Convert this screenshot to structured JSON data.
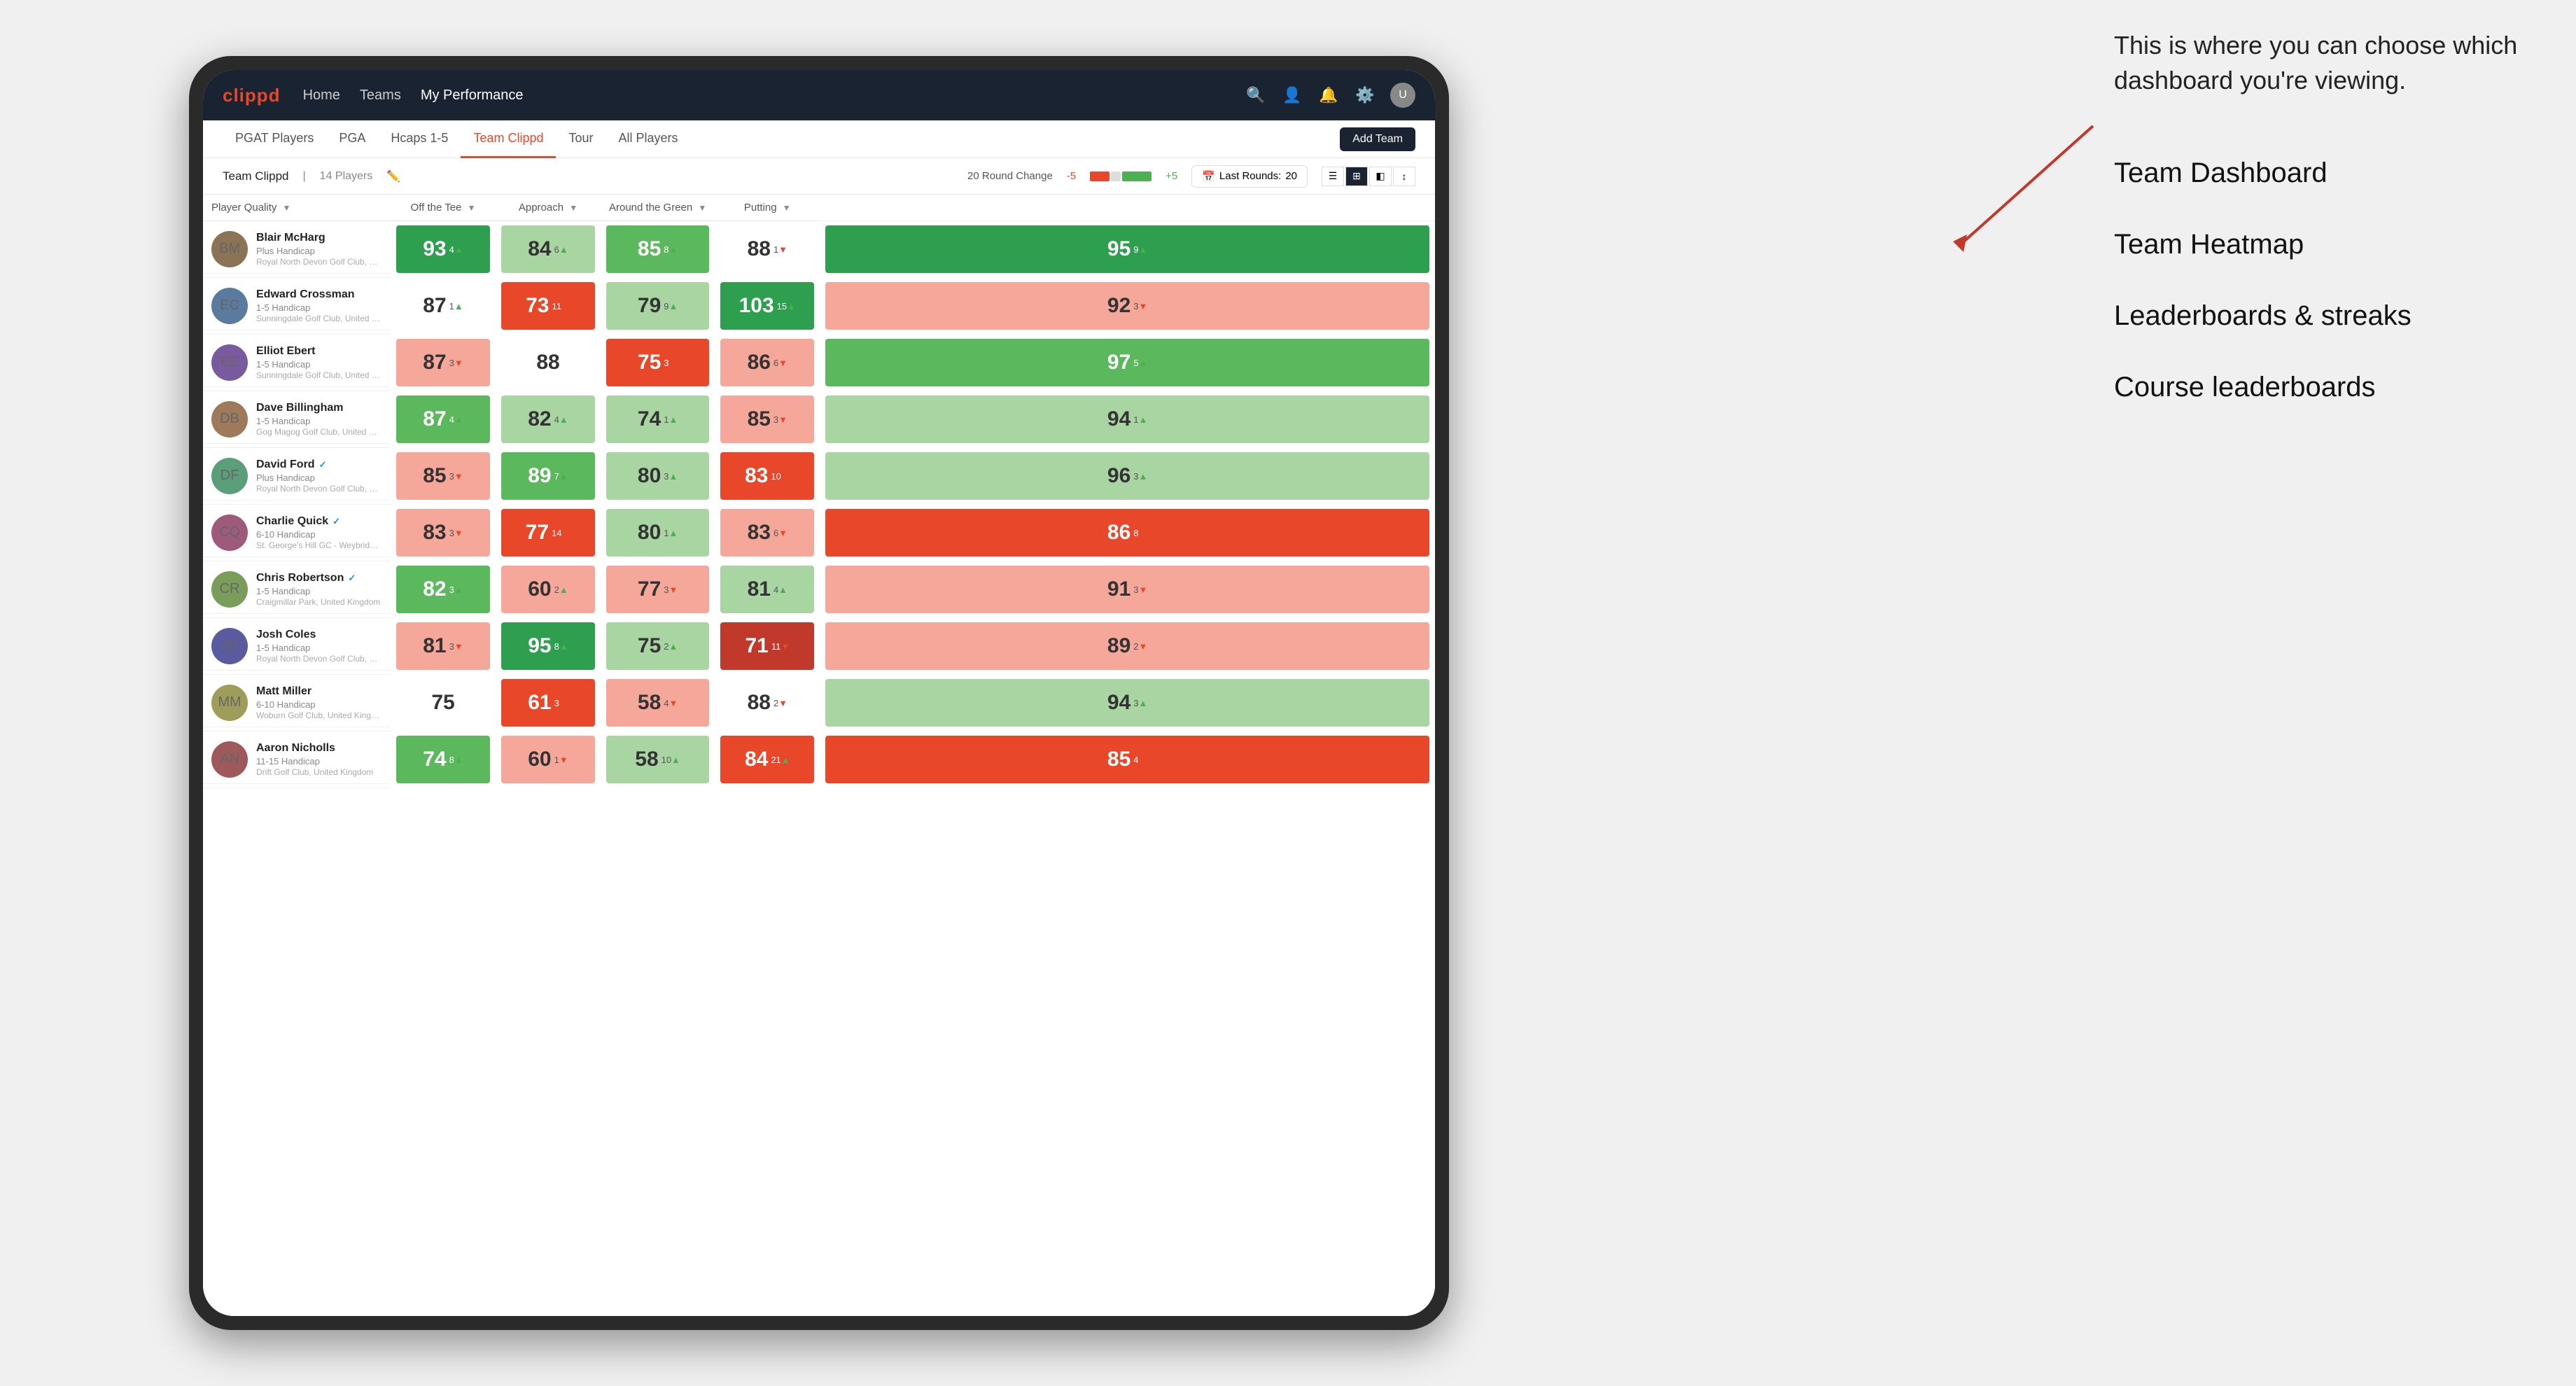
{
  "annotation": {
    "description": "This is where you can choose which dashboard you're viewing.",
    "menu_options": [
      "Team Dashboard",
      "Team Heatmap",
      "Leaderboards & streaks",
      "Course leaderboards"
    ]
  },
  "nav": {
    "logo": "clippd",
    "items": [
      "Home",
      "Teams",
      "My Performance"
    ],
    "active_item": "My Performance"
  },
  "sub_nav": {
    "items": [
      "PGAT Players",
      "PGA",
      "Hcaps 1-5",
      "Team Clippd",
      "Tour",
      "All Players"
    ],
    "active_item": "Team Clippd",
    "add_team_label": "Add Team"
  },
  "team_header": {
    "title": "Team Clippd",
    "separator": "|",
    "count": "14 Players",
    "round_change_label": "20 Round Change",
    "change_neg": "-5",
    "change_pos": "+5",
    "last_rounds_label": "Last Rounds:",
    "last_rounds_value": "20"
  },
  "table": {
    "columns": [
      {
        "id": "player",
        "label": "Player Quality",
        "sortable": true
      },
      {
        "id": "off_tee",
        "label": "Off the Tee",
        "sortable": true
      },
      {
        "id": "approach",
        "label": "Approach",
        "sortable": true
      },
      {
        "id": "around_green",
        "label": "Around the Green",
        "sortable": true
      },
      {
        "id": "putting",
        "label": "Putting",
        "sortable": true
      }
    ],
    "players": [
      {
        "name": "Blair McHarg",
        "handicap": "Plus Handicap",
        "club": "Royal North Devon Golf Club, United Kingdom",
        "verified": false,
        "avatar_color": "av1",
        "initials": "BM",
        "scores": [
          {
            "value": 93,
            "change": 4,
            "dir": "up",
            "bg": "bg-green-dark",
            "text": "score-colored"
          },
          {
            "value": 84,
            "change": 6,
            "dir": "up",
            "bg": "bg-green-light",
            "text": "score-white"
          },
          {
            "value": 85,
            "change": 8,
            "dir": "up",
            "bg": "bg-green-mid",
            "text": "score-colored"
          },
          {
            "value": 88,
            "change": 1,
            "dir": "down",
            "bg": "bg-white",
            "text": "score-white"
          },
          {
            "value": 95,
            "change": 9,
            "dir": "up",
            "bg": "bg-green-dark",
            "text": "score-colored"
          }
        ]
      },
      {
        "name": "Edward Crossman",
        "handicap": "1-5 Handicap",
        "club": "Sunningdale Golf Club, United Kingdom",
        "verified": false,
        "avatar_color": "av2",
        "initials": "EC",
        "scores": [
          {
            "value": 87,
            "change": 1,
            "dir": "up",
            "bg": "bg-white",
            "text": "score-white"
          },
          {
            "value": 73,
            "change": 11,
            "dir": "down",
            "bg": "bg-red-mid",
            "text": "score-colored"
          },
          {
            "value": 79,
            "change": 9,
            "dir": "up",
            "bg": "bg-green-light",
            "text": "score-white"
          },
          {
            "value": 103,
            "change": 15,
            "dir": "up",
            "bg": "bg-green-dark",
            "text": "score-colored"
          },
          {
            "value": 92,
            "change": 3,
            "dir": "down",
            "bg": "bg-red-light",
            "text": "score-white"
          }
        ]
      },
      {
        "name": "Elliot Ebert",
        "handicap": "1-5 Handicap",
        "club": "Sunningdale Golf Club, United Kingdom",
        "verified": false,
        "avatar_color": "av3",
        "initials": "EE",
        "scores": [
          {
            "value": 87,
            "change": 3,
            "dir": "down",
            "bg": "bg-red-light",
            "text": "score-white"
          },
          {
            "value": 88,
            "change": null,
            "dir": null,
            "bg": "bg-white",
            "text": "score-white"
          },
          {
            "value": 75,
            "change": 3,
            "dir": "down",
            "bg": "bg-red-mid",
            "text": "score-colored"
          },
          {
            "value": 86,
            "change": 6,
            "dir": "down",
            "bg": "bg-red-light",
            "text": "score-white"
          },
          {
            "value": 97,
            "change": 5,
            "dir": "up",
            "bg": "bg-green-mid",
            "text": "score-colored"
          }
        ]
      },
      {
        "name": "Dave Billingham",
        "handicap": "1-5 Handicap",
        "club": "Gog Magog Golf Club, United Kingdom",
        "verified": false,
        "avatar_color": "av4",
        "initials": "DB",
        "scores": [
          {
            "value": 87,
            "change": 4,
            "dir": "up",
            "bg": "bg-green-mid",
            "text": "score-colored"
          },
          {
            "value": 82,
            "change": 4,
            "dir": "up",
            "bg": "bg-green-light",
            "text": "score-white"
          },
          {
            "value": 74,
            "change": 1,
            "dir": "up",
            "bg": "bg-green-light",
            "text": "score-white"
          },
          {
            "value": 85,
            "change": 3,
            "dir": "down",
            "bg": "bg-red-light",
            "text": "score-white"
          },
          {
            "value": 94,
            "change": 1,
            "dir": "up",
            "bg": "bg-green-light",
            "text": "score-white"
          }
        ]
      },
      {
        "name": "David Ford",
        "handicap": "Plus Handicap",
        "club": "Royal North Devon Golf Club, United Kingdom",
        "verified": true,
        "avatar_color": "av5",
        "initials": "DF",
        "scores": [
          {
            "value": 85,
            "change": 3,
            "dir": "down",
            "bg": "bg-red-light",
            "text": "score-white"
          },
          {
            "value": 89,
            "change": 7,
            "dir": "up",
            "bg": "bg-green-mid",
            "text": "score-colored"
          },
          {
            "value": 80,
            "change": 3,
            "dir": "up",
            "bg": "bg-green-light",
            "text": "score-white"
          },
          {
            "value": 83,
            "change": 10,
            "dir": "down",
            "bg": "bg-red-mid",
            "text": "score-colored"
          },
          {
            "value": 96,
            "change": 3,
            "dir": "up",
            "bg": "bg-green-light",
            "text": "score-white"
          }
        ]
      },
      {
        "name": "Charlie Quick",
        "handicap": "6-10 Handicap",
        "club": "St. George's Hill GC - Weybridge - Surrey, Uni...",
        "verified": true,
        "avatar_color": "av6",
        "initials": "CQ",
        "scores": [
          {
            "value": 83,
            "change": 3,
            "dir": "down",
            "bg": "bg-red-light",
            "text": "score-white"
          },
          {
            "value": 77,
            "change": 14,
            "dir": "down",
            "bg": "bg-red-mid",
            "text": "score-colored"
          },
          {
            "value": 80,
            "change": 1,
            "dir": "up",
            "bg": "bg-green-light",
            "text": "score-white"
          },
          {
            "value": 83,
            "change": 6,
            "dir": "down",
            "bg": "bg-red-light",
            "text": "score-white"
          },
          {
            "value": 86,
            "change": 8,
            "dir": "down",
            "bg": "bg-red-mid",
            "text": "score-colored"
          }
        ]
      },
      {
        "name": "Chris Robertson",
        "handicap": "1-5 Handicap",
        "club": "Craigmillar Park, United Kingdom",
        "verified": true,
        "avatar_color": "av7",
        "initials": "CR",
        "scores": [
          {
            "value": 82,
            "change": 3,
            "dir": "up",
            "bg": "bg-green-mid",
            "text": "score-colored"
          },
          {
            "value": 60,
            "change": 2,
            "dir": "up",
            "bg": "bg-red-light",
            "text": "score-white"
          },
          {
            "value": 77,
            "change": 3,
            "dir": "down",
            "bg": "bg-red-light",
            "text": "score-white"
          },
          {
            "value": 81,
            "change": 4,
            "dir": "up",
            "bg": "bg-green-light",
            "text": "score-white"
          },
          {
            "value": 91,
            "change": 3,
            "dir": "down",
            "bg": "bg-red-light",
            "text": "score-white"
          }
        ]
      },
      {
        "name": "Josh Coles",
        "handicap": "1-5 Handicap",
        "club": "Royal North Devon Golf Club, United Kingdom",
        "verified": false,
        "avatar_color": "av8",
        "initials": "JC",
        "scores": [
          {
            "value": 81,
            "change": 3,
            "dir": "down",
            "bg": "bg-red-light",
            "text": "score-white"
          },
          {
            "value": 95,
            "change": 8,
            "dir": "up",
            "bg": "bg-green-dark",
            "text": "score-colored"
          },
          {
            "value": 75,
            "change": 2,
            "dir": "up",
            "bg": "bg-green-light",
            "text": "score-white"
          },
          {
            "value": 71,
            "change": 11,
            "dir": "down",
            "bg": "bg-red-dark",
            "text": "score-colored"
          },
          {
            "value": 89,
            "change": 2,
            "dir": "down",
            "bg": "bg-red-light",
            "text": "score-white"
          }
        ]
      },
      {
        "name": "Matt Miller",
        "handicap": "6-10 Handicap",
        "club": "Woburn Golf Club, United Kingdom",
        "verified": false,
        "avatar_color": "av9",
        "initials": "MM",
        "scores": [
          {
            "value": 75,
            "change": null,
            "dir": null,
            "bg": "bg-white",
            "text": "score-white"
          },
          {
            "value": 61,
            "change": 3,
            "dir": "down",
            "bg": "bg-red-mid",
            "text": "score-colored"
          },
          {
            "value": 58,
            "change": 4,
            "dir": "down",
            "bg": "bg-red-light",
            "text": "score-white"
          },
          {
            "value": 88,
            "change": 2,
            "dir": "down",
            "bg": "bg-white",
            "text": "score-white"
          },
          {
            "value": 94,
            "change": 3,
            "dir": "up",
            "bg": "bg-green-light",
            "text": "score-white"
          }
        ]
      },
      {
        "name": "Aaron Nicholls",
        "handicap": "11-15 Handicap",
        "club": "Drift Golf Club, United Kingdom",
        "verified": false,
        "avatar_color": "av10",
        "initials": "AN",
        "scores": [
          {
            "value": 74,
            "change": 8,
            "dir": "up",
            "bg": "bg-green-mid",
            "text": "score-colored"
          },
          {
            "value": 60,
            "change": 1,
            "dir": "down",
            "bg": "bg-red-light",
            "text": "score-white"
          },
          {
            "value": 58,
            "change": 10,
            "dir": "up",
            "bg": "bg-green-light",
            "text": "score-white"
          },
          {
            "value": 84,
            "change": 21,
            "dir": "up",
            "bg": "bg-red-mid",
            "text": "score-colored"
          },
          {
            "value": 85,
            "change": 4,
            "dir": "down",
            "bg": "bg-red-mid",
            "text": "score-colored"
          }
        ]
      }
    ]
  }
}
